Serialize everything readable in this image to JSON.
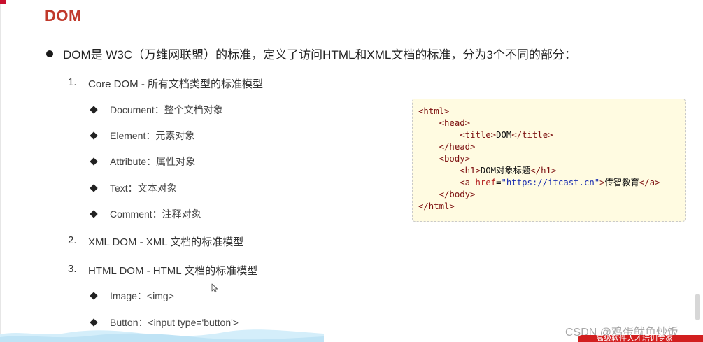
{
  "title": "DOM",
  "main_bullet": "DOM是 W3C（万维网联盟）的标准，定义了访问HTML和XML文档的标准，分为3个不同的部分：",
  "sections": [
    {
      "num": "1.",
      "label": "Core DOM - 所有文档类型的标准模型"
    },
    {
      "num": "2.",
      "label": "XML DOM - XML 文档的标准模型"
    },
    {
      "num": "3.",
      "label": "HTML DOM - HTML 文档的标准模型"
    }
  ],
  "core_items": [
    "Document：整个文档对象",
    "Element：元素对象",
    "Attribute：属性对象",
    "Text：文本对象",
    "Comment：注释对象"
  ],
  "html_items": [
    "Image：<img>",
    "Button：<input type='button'>"
  ],
  "code": {
    "html_open": "<html>",
    "head_open": "<head>",
    "title_open": "<title>",
    "title_text": "DOM",
    "title_close": "</title>",
    "head_close": "</head>",
    "body_open": "<body>",
    "h1_open": "<h1>",
    "h1_text": "DOM对象标题",
    "h1_close": "</h1>",
    "a_open_start": "<a ",
    "a_attr": "href",
    "a_eq": "=",
    "a_value": "\"https://itcast.cn\"",
    "a_open_end": ">",
    "a_text": "传智教育",
    "a_close": "</a>",
    "body_close": "</body>",
    "html_close": "</html>"
  },
  "watermark": "CSDN @鸡蛋鱿鱼炒饭",
  "ribbon_text": "高级软件人才培训专家",
  "colors": {
    "title": "#c0392b",
    "code_bg": "#fffbe1",
    "code_tag": "#7d1111",
    "code_attr": "#b51e1e",
    "code_string": "#1a2db0",
    "ribbon": "#d21f1f"
  },
  "icons": [
    "cursor-arrow-icon"
  ]
}
